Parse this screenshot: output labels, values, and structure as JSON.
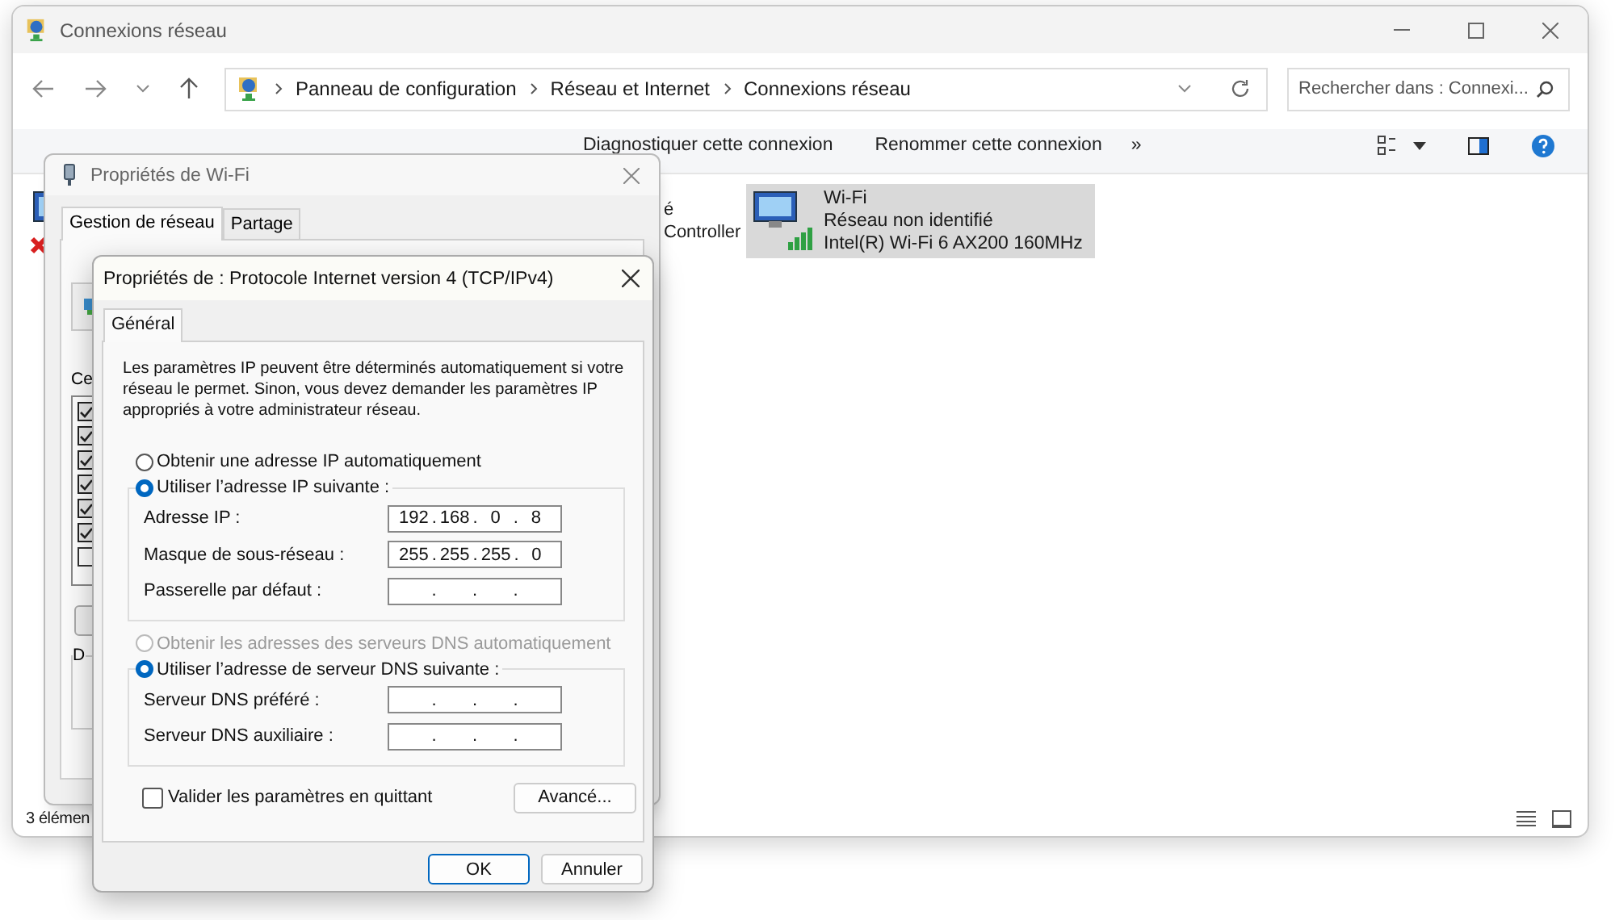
{
  "explorer": {
    "title": "Connexions réseau",
    "breadcrumbs": [
      "Panneau de configuration",
      "Réseau et Internet",
      "Connexions réseau"
    ],
    "search_placeholder": "Rechercher dans : Connexi...",
    "toolbar": [
      "Diagnostiquer cette connexion",
      "Renommer cette connexion"
    ],
    "overflow": "»",
    "items": [
      {
        "kind": "hidden",
        "selected": false,
        "disconnected": true
      },
      {
        "kind": "partial",
        "selected": false,
        "lines": [
          "é",
          "Controller"
        ]
      },
      {
        "kind": "full",
        "selected": true,
        "disconnected": false,
        "lines": [
          "Wi-Fi",
          "Réseau non identifié",
          "Intel(R) Wi-Fi 6 AX200 160MHz"
        ]
      }
    ],
    "status": "3 élémen"
  },
  "wifi_dialog": {
    "title": "Propriétés de Wi-Fi",
    "tabs": [
      {
        "label": "Gestion de réseau",
        "selected": true
      },
      {
        "label": "Partage",
        "selected": false
      }
    ],
    "components_label": "Ce",
    "components": [
      {
        "checked": true
      },
      {
        "checked": true
      },
      {
        "checked": true
      },
      {
        "checked": true
      },
      {
        "checked": true
      },
      {
        "checked": true
      },
      {
        "checked": false
      }
    ],
    "description_label": "D"
  },
  "ipv4_dialog": {
    "title": "Propriétés de : Protocole Internet version 4 (TCP/IPv4)",
    "tabs": [
      {
        "label": "Général",
        "selected": true
      }
    ],
    "intro": [
      "Les paramètres IP peuvent être déterminés automatiquement si votre",
      "réseau le permet. Sinon, vous devez demander les paramètres IP",
      "appropriés à votre administrateur réseau."
    ],
    "separator": ".",
    "ip_options": [
      {
        "label": "Obtenir une adresse IP automatiquement",
        "selected": false,
        "disabled": false
      },
      {
        "label": "Utiliser l’adresse IP suivante :",
        "selected": true,
        "disabled": false
      }
    ],
    "ip_fields": [
      {
        "label": "Adresse IP :",
        "octets": [
          "192",
          "168",
          "0",
          "8"
        ]
      },
      {
        "label": "Masque de sous-réseau :",
        "octets": [
          "255",
          "255",
          "255",
          "0"
        ]
      },
      {
        "label": "Passerelle par défaut :"
      }
    ],
    "dns_options": [
      {
        "label": "Obtenir les adresses des serveurs DNS automatiquement",
        "selected": false,
        "disabled": true
      },
      {
        "label": "Utiliser l’adresse de serveur DNS suivante :",
        "selected": true,
        "disabled": false
      }
    ],
    "dns_fields": [
      {
        "label": "Serveur DNS préféré :"
      },
      {
        "label": "Serveur DNS auxiliaire :"
      }
    ],
    "validate": {
      "label": "Valider les paramètres en quittant",
      "checked": false
    },
    "advanced_button": "Avancé...",
    "buttons": [
      {
        "label": "OK",
        "default": true
      },
      {
        "label": "Annuler",
        "default": false
      }
    ]
  }
}
